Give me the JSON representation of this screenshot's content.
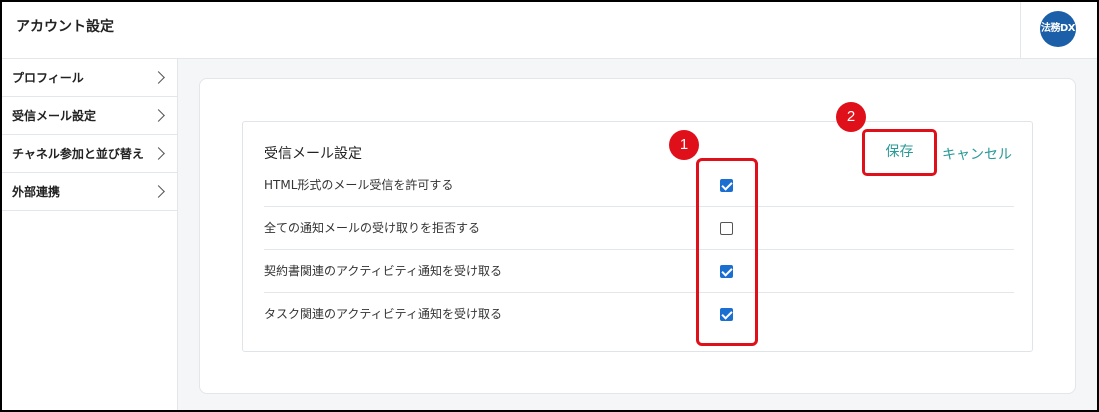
{
  "header": {
    "title": "アカウント設定",
    "logo_text": "法務DX"
  },
  "sidebar": {
    "items": [
      {
        "label": "プロフィール"
      },
      {
        "label": "受信メール設定"
      },
      {
        "label": "チャネル参加と並び替え"
      },
      {
        "label": "外部連携"
      }
    ]
  },
  "section": {
    "title": "受信メール設定",
    "save_label": "保存",
    "cancel_label": "キャンセル",
    "options": [
      {
        "label": "HTML形式のメール受信を許可する",
        "checked": true
      },
      {
        "label": "全ての通知メールの受け取りを拒否する",
        "checked": false
      },
      {
        "label": "契約書関連のアクティビティ通知を受け取る",
        "checked": true
      },
      {
        "label": "タスク関連のアクティビティ通知を受け取る",
        "checked": true
      }
    ]
  },
  "annotations": {
    "marker_1": "1",
    "marker_2": "2"
  },
  "colors": {
    "accent": "#2a9a97",
    "highlight": "#e0101a",
    "checkbox": "#1a6fd1",
    "logo": "#1a5fa8"
  }
}
